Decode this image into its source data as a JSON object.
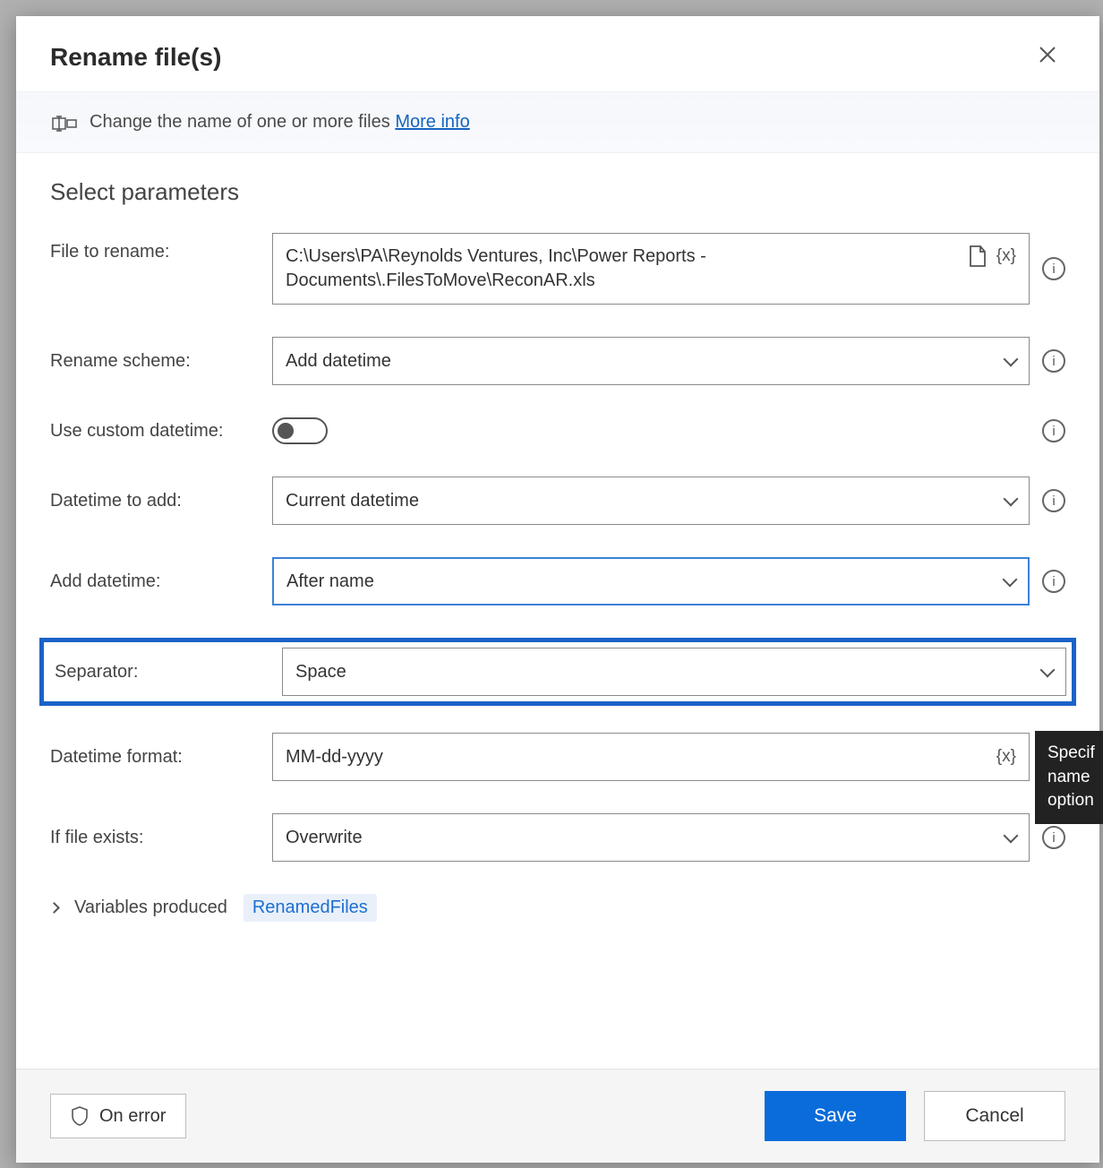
{
  "dialog": {
    "title": "Rename file(s)",
    "description": "Change the name of one or more files",
    "moreInfo": "More info"
  },
  "section": {
    "title": "Select parameters"
  },
  "fields": {
    "fileToRename": {
      "label": "File to rename:",
      "value": "C:\\Users\\PA\\Reynolds Ventures, Inc\\Power Reports - Documents\\.FilesToMove\\ReconAR.xls"
    },
    "renameScheme": {
      "label": "Rename scheme:",
      "value": "Add datetime"
    },
    "useCustomDatetime": {
      "label": "Use custom datetime:",
      "value": false
    },
    "datetimeToAdd": {
      "label": "Datetime to add:",
      "value": "Current datetime"
    },
    "addDatetime": {
      "label": "Add datetime:",
      "value": "After name"
    },
    "separator": {
      "label": "Separator:",
      "value": "Space"
    },
    "datetimeFormat": {
      "label": "Datetime format:",
      "value": "MM-dd-yyyy"
    },
    "ifFileExists": {
      "label": "If file exists:",
      "value": "Overwrite"
    }
  },
  "variables": {
    "label": "Variables produced",
    "produced": "RenamedFiles"
  },
  "tooltip": {
    "line1": "Specif",
    "line2": "name ",
    "line3": "option"
  },
  "footer": {
    "onError": "On error",
    "save": "Save",
    "cancel": "Cancel"
  },
  "tokens": {
    "varToken": "{x}"
  }
}
